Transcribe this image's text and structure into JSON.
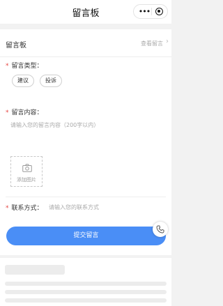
{
  "nav": {
    "title": "留言板"
  },
  "board": {
    "title": "留言板",
    "view_link": "查看留言",
    "view_arrow": "›"
  },
  "form": {
    "type_label": "留言类型：",
    "types": [
      "建议",
      "投诉"
    ],
    "content_label": "留言内容：",
    "content_placeholder": "请输入您的留言内容（200字以内）",
    "upload_label": "添加图片",
    "contact_label": "联系方式：",
    "contact_placeholder": "请输入您的联系方式",
    "required_mark": "*",
    "submit_label": "提交留言"
  },
  "colors": {
    "accent": "#4a8ef6",
    "required": "#e64340"
  },
  "icons": [
    "more-dots-icon",
    "target-icon",
    "camera-icon",
    "phone-icon",
    "chevron-right-icon"
  ]
}
